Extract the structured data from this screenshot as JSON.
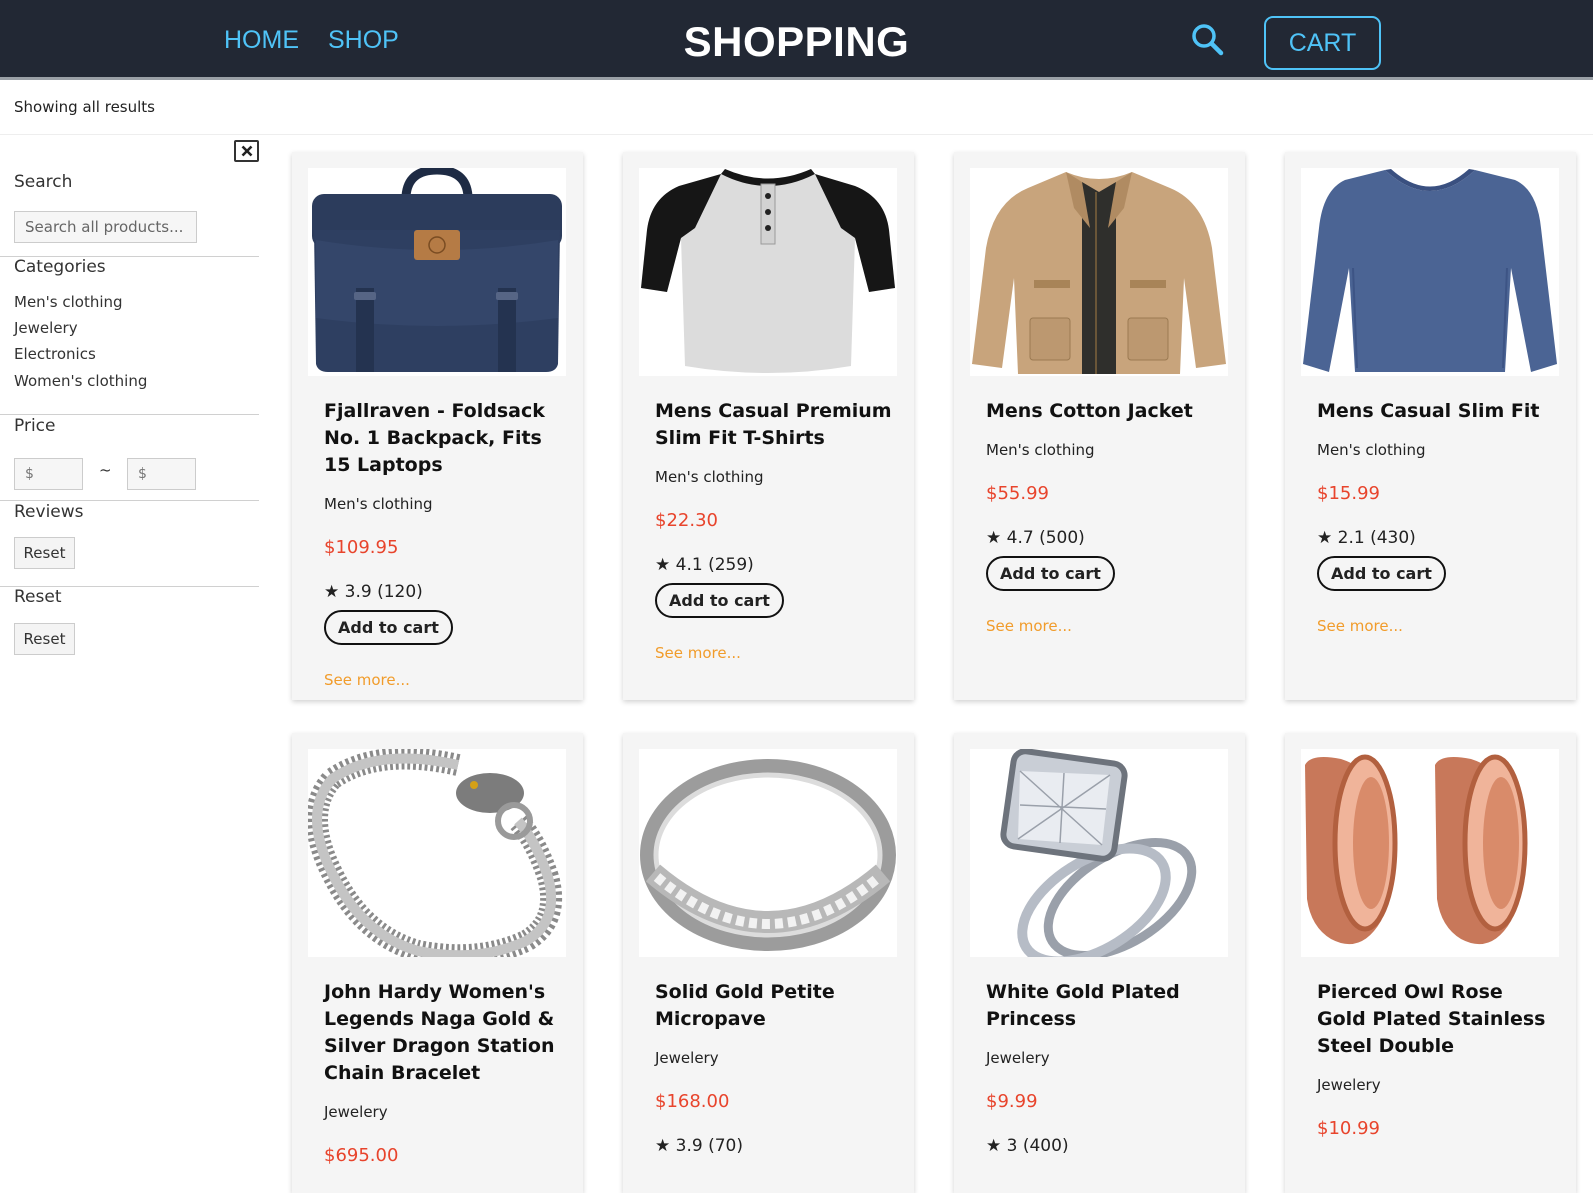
{
  "header": {
    "nav": [
      {
        "label": "HOME"
      },
      {
        "label": "SHOP"
      }
    ],
    "title": "SHOPPING",
    "cart_label": "CART",
    "search_icon": "search-icon"
  },
  "results": {
    "text": "Showing all results"
  },
  "sidebar": {
    "search": {
      "heading": "Search",
      "placeholder": "Search all products..."
    },
    "categories": {
      "heading": "Categories",
      "items": [
        {
          "label": "Men's clothing"
        },
        {
          "label": "Jewelery"
        },
        {
          "label": "Electronics"
        },
        {
          "label": "Women's clothing"
        }
      ]
    },
    "price": {
      "heading": "Price",
      "min_placeholder": "$",
      "max_placeholder": "$",
      "separator": "~"
    },
    "reviews": {
      "heading": "Reviews",
      "reset_label": "Reset"
    },
    "reset": {
      "heading": "Reset",
      "reset_label": "Reset"
    }
  },
  "products": [
    {
      "title": "Fjallraven - Foldsack No. 1 Backpack, Fits 15 Laptops",
      "category": "Men's clothing",
      "price": "$109.95",
      "rating": "★ 3.9 (120)",
      "add_label": "Add to cart",
      "more_label": "See more...",
      "image": "backpack"
    },
    {
      "title": "Mens Casual Premium Slim Fit T-Shirts",
      "category": "Men's clothing",
      "price": "$22.30",
      "rating": "★ 4.1 (259)",
      "add_label": "Add to cart",
      "more_label": "See more...",
      "image": "raglan-tshirt"
    },
    {
      "title": "Mens Cotton Jacket",
      "category": "Men's clothing",
      "price": "$55.99",
      "rating": "★ 4.7 (500)",
      "add_label": "Add to cart",
      "more_label": "See more...",
      "image": "jacket"
    },
    {
      "title": "Mens Casual Slim Fit",
      "category": "Men's clothing",
      "price": "$15.99",
      "rating": "★ 2.1 (430)",
      "add_label": "Add to cart",
      "more_label": "See more...",
      "image": "long-sleeve-shirt"
    },
    {
      "title": "John Hardy Women's Legends Naga Gold & Silver Dragon Station Chain Bracelet",
      "category": "Jewelery",
      "price": "$695.00",
      "image": "dragon-bracelet"
    },
    {
      "title": "Solid Gold Petite Micropave",
      "category": "Jewelery",
      "price": "$168.00",
      "rating": "★ 3.9 (70)",
      "image": "silver-ring"
    },
    {
      "title": "White Gold Plated Princess",
      "category": "Jewelery",
      "price": "$9.99",
      "rating": "★ 3 (400)",
      "image": "diamond-ring"
    },
    {
      "title": "Pierced Owl Rose Gold Plated Stainless Steel Double",
      "category": "Jewelery",
      "price": "$10.99",
      "image": "rose-gold-plugs"
    }
  ],
  "colors": {
    "header_bg": "#222834",
    "nav_accent": "#4fc3f7",
    "price": "#e8442c",
    "see_more": "#f19c2b",
    "card_bg": "#f5f5f5"
  }
}
